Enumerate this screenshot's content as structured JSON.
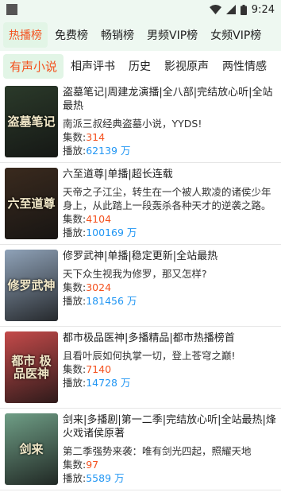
{
  "status": {
    "time": "9:24"
  },
  "tabs_primary": [
    "热播榜",
    "免费榜",
    "畅销榜",
    "男频VIP榜",
    "女频VIP榜"
  ],
  "tabs_secondary": [
    "有声小说",
    "相声评书",
    "历史",
    "影视原声",
    "两性情感"
  ],
  "items": [
    {
      "title": "盗墓笔记|周建龙演播|全八部|完结放心听|全站最热",
      "desc": "南派三叔经典盗墓小说，YYDS!",
      "episodes_label": "集数:",
      "episodes": "314",
      "plays_label": "播放:",
      "plays": "62139 万",
      "cover_text": "盗墓笔记",
      "cover_color": "#2b3a2a"
    },
    {
      "title": "六至道尊|单播|超长连载",
      "desc": "天帝之子江尘，转生在一个被人欺凌的诸侯少年身上，从此踏上一段轰杀各种天才的逆袭之路。",
      "episodes_label": "集数:",
      "episodes": "4104",
      "plays_label": "播放:",
      "plays": "100169 万",
      "cover_text": "六至道尊",
      "cover_color": "#3a2a1e"
    },
    {
      "title": "修罗武神|单播|稳定更新|全站最热",
      "desc": "天下众生视我为修罗，那又怎样?",
      "episodes_label": "集数:",
      "episodes": "3024",
      "plays_label": "播放:",
      "plays": "181456 万",
      "cover_text": "修罗武神",
      "cover_color": "#8fa2b8"
    },
    {
      "title": "都市极品医神|多播精品|都市热播榜首",
      "desc": "且看叶辰如何执掌一切，登上苍穹之巅!",
      "episodes_label": "集数:",
      "episodes": "7140",
      "plays_label": "播放:",
      "plays": "14728 万",
      "cover_text": "都市 极品医神",
      "cover_color": "#c44a4a"
    },
    {
      "title": "剑来|多播剧|第一二季|完结放心听|全站最热|烽火戏诸侯原著",
      "desc": "第二季强势来袭：唯有剑光四起，照耀天地",
      "episodes_label": "集数:",
      "episodes": "97",
      "plays_label": "播放:",
      "plays": "5589 万",
      "cover_text": "剑来",
      "cover_color": "#6f9e86"
    }
  ]
}
